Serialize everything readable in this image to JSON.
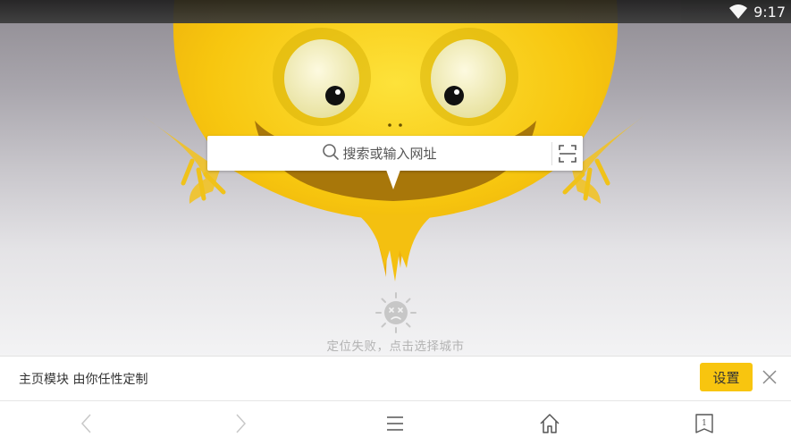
{
  "status_bar": {
    "time": "9:17",
    "wifi_icon": "wifi-icon"
  },
  "search": {
    "placeholder": "搜索或输入网址",
    "search_icon": "search-icon",
    "scan_icon": "scan-icon"
  },
  "weather": {
    "message": "定位失败，点击选择城市",
    "icon": "sad-sun-icon"
  },
  "banner": {
    "text": "主页模块 由你任性定制",
    "settings_label": "设置",
    "accent": "#f8c50f",
    "close_icon": "close-icon"
  },
  "toolbar": {
    "back_icon": "chevron-left-icon",
    "forward_icon": "chevron-right-icon",
    "menu_icon": "menu-icon",
    "home_icon": "home-icon",
    "tabs_count": "1"
  },
  "colors": {
    "mascot_yellow": "#f7c60f",
    "eye_white": "#f8f3c0",
    "text_gray": "#b3b3b3"
  }
}
